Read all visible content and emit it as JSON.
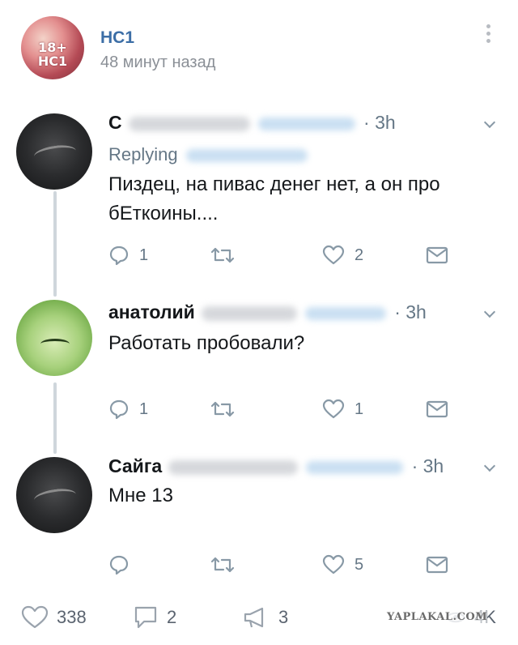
{
  "post": {
    "group_name": "НС1",
    "time": "48 минут назад",
    "avatar_text": "18+\nНС1"
  },
  "tweets": [
    {
      "name": "С",
      "time": "· 3h",
      "replying_to": "Replying",
      "text": "Пиздец, на пивас денег нет, а он про бЕткоины....",
      "reply_count": "1",
      "retweet_count": "",
      "like_count": "2"
    },
    {
      "name": "анатолий",
      "time": "· 3h",
      "text": "Работать пробовали?",
      "reply_count": "1",
      "retweet_count": "",
      "like_count": "1"
    },
    {
      "name": "Сайга",
      "time": "· 3h",
      "text": "Мне 13",
      "reply_count": "",
      "retweet_count": "",
      "like_count": "5"
    }
  ],
  "footer": {
    "likes": "338",
    "comments": "2",
    "shares": "3",
    "views": "4K"
  },
  "watermark": "YAPLAKAL.COM",
  "colors": {
    "group_name": "#3c6ea6",
    "muted": "#657786",
    "icon": "#8899a6",
    "footer_icon": "#9aa3ad"
  },
  "icons": {
    "reply": "speech-bubble-icon",
    "retweet": "retweet-icon",
    "like": "heart-icon",
    "dm": "envelope-icon",
    "menu": "vertical-dots-icon",
    "chevron": "chevron-down-icon"
  }
}
